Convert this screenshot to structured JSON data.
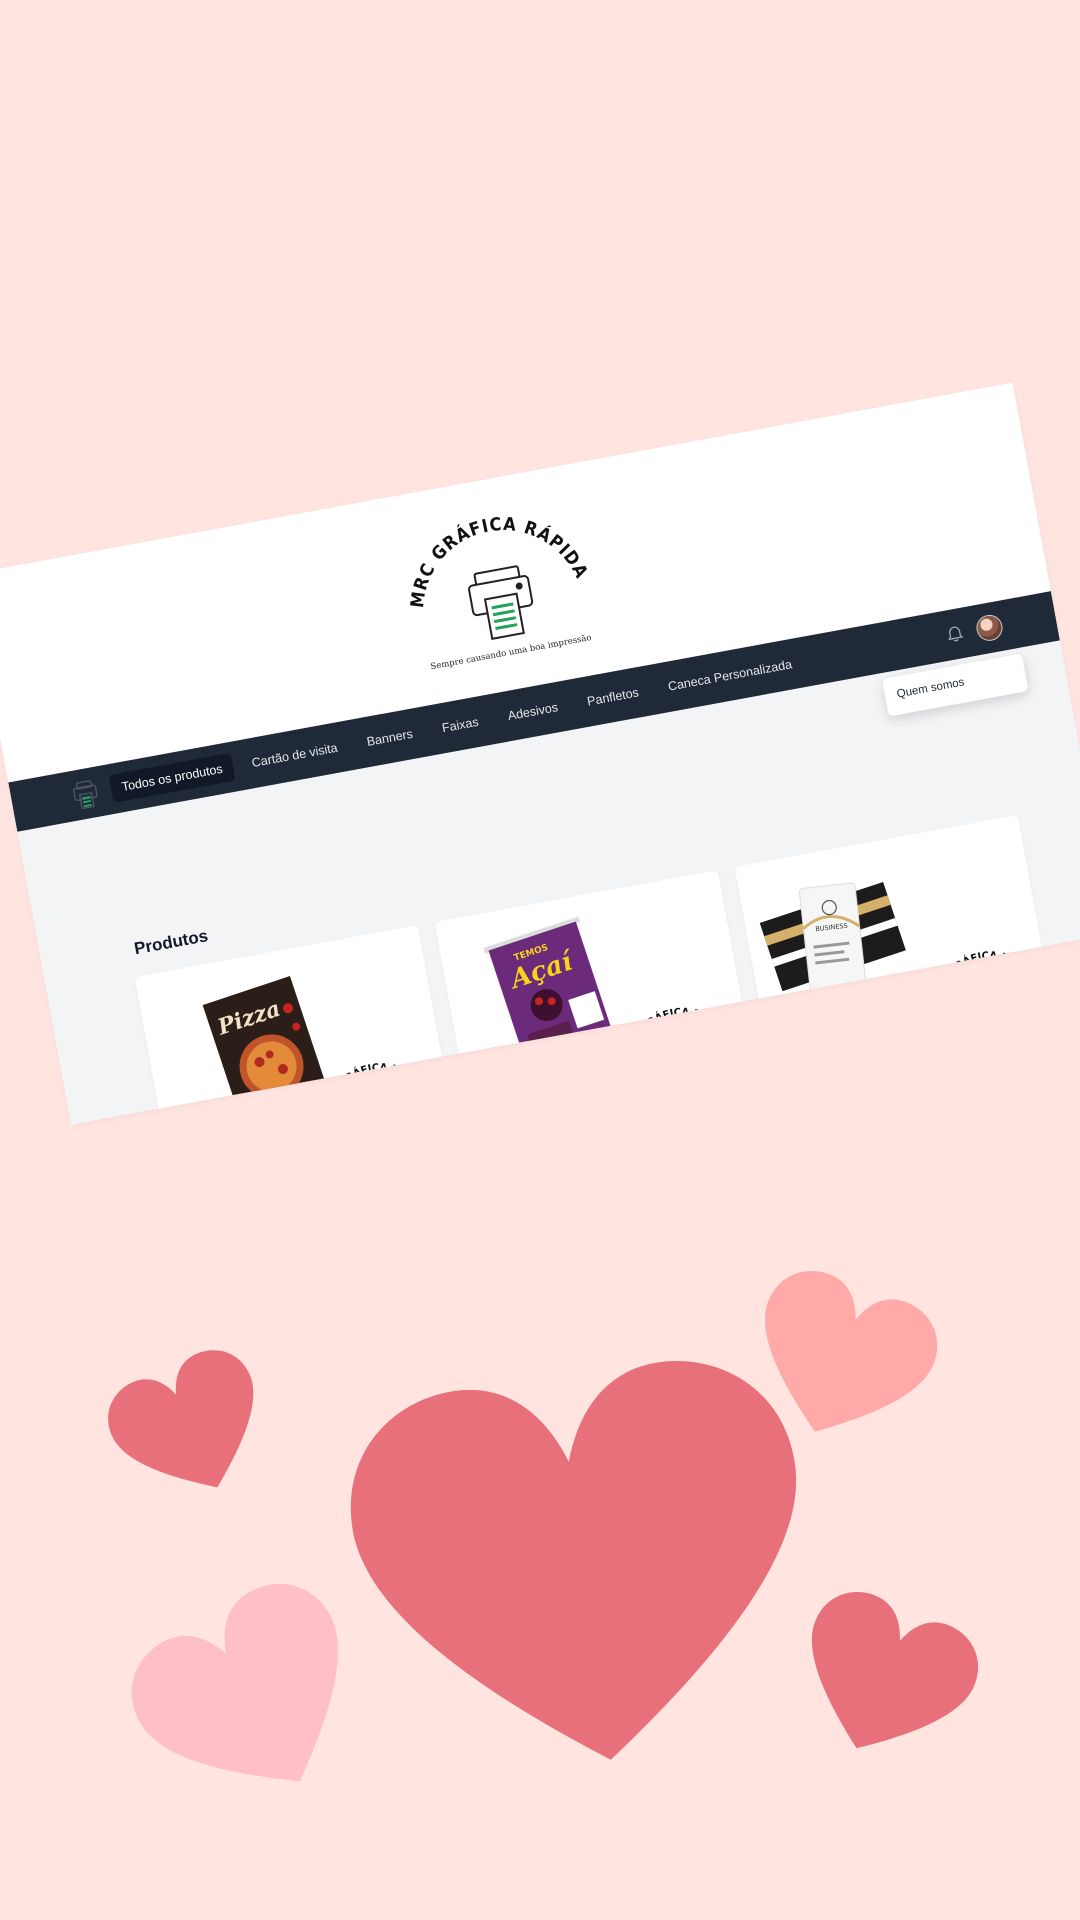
{
  "brand": {
    "name": "MRC GRÁFICA RÁPIDA",
    "tagline": "Sempre causando uma boa impressão"
  },
  "nav": {
    "items": [
      {
        "label": "Todos os produtos",
        "active": true
      },
      {
        "label": "Cartão de visita",
        "active": false
      },
      {
        "label": "Banners",
        "active": false
      },
      {
        "label": "Faixas",
        "active": false
      },
      {
        "label": "Adesivos",
        "active": false
      },
      {
        "label": "Panfletos",
        "active": false
      },
      {
        "label": "Caneca Personalizada",
        "active": false
      }
    ],
    "notification_icon": "bell-icon",
    "avatar_icon": "user-avatar"
  },
  "user_menu": {
    "items": [
      "Quem somos"
    ]
  },
  "products": {
    "title": "Produtos",
    "cards": [
      {
        "image_text": "Pizza",
        "watermark": "MRC GRÁFICA RÁPIDA"
      },
      {
        "image_text_top": "TEMOS",
        "image_text": "Açaí",
        "watermark": "MRC GRÁFICA RÁPIDA"
      },
      {
        "image_text": "BUSINESS",
        "watermark": "MRC GRÁFICA RÁPIDA"
      }
    ]
  },
  "colors": {
    "background": "#ffe4e0",
    "nav_background": "#1f2937",
    "heart_dark": "#e8707b",
    "heart_light": "#ffa9a8",
    "heart_pink": "#ffbfc7"
  }
}
